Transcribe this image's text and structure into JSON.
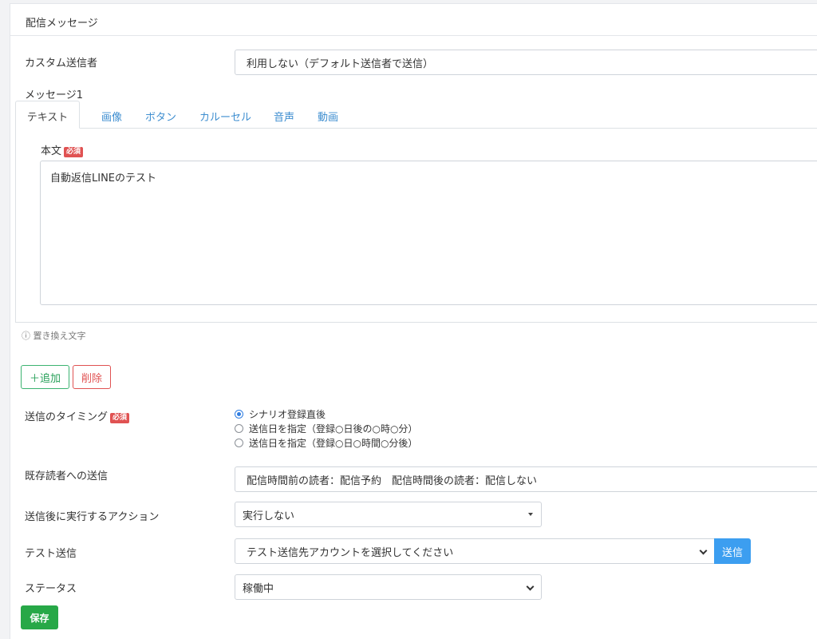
{
  "panel": {
    "title": "配信メッセージ"
  },
  "custom_sender": {
    "label": "カスタム送信者",
    "value": "利用しない（デフォルト送信者で送信）"
  },
  "message": {
    "heading": "メッセージ1",
    "tabs": [
      "テキスト",
      "画像",
      "ボタン",
      "カルーセル",
      "音声",
      "動画"
    ],
    "active_tab": "テキスト",
    "body_label": "本文",
    "required_badge": "必須",
    "body_value": "自動返信LINEのテスト",
    "hint": "ⓘ 置き換え文字"
  },
  "actions": {
    "add_label": "＋追加",
    "delete_label": "削除"
  },
  "timing": {
    "label": "送信のタイミング",
    "required_badge": "必須",
    "options": [
      {
        "label": "シナリオ登録直後",
        "checked": true
      },
      {
        "label": "送信日を指定（登録○日後の○時○分）",
        "checked": false
      },
      {
        "label": "送信日を指定（登録○日○時間○分後）",
        "checked": false
      }
    ]
  },
  "existing_readers": {
    "label": "既存読者への送信",
    "value": "配信時間前の読者：配信予約　配信時間後の読者：配信しない"
  },
  "post_action": {
    "label": "送信後に実行するアクション",
    "value": "実行しない"
  },
  "test_send": {
    "label": "テスト送信",
    "value": "テスト送信先アカウントを選択してください",
    "button": "送信"
  },
  "status": {
    "label": "ステータス",
    "value": "稼働中"
  },
  "save_button": "保存",
  "colors": {
    "accent_blue": "#3c9ef0",
    "save_green": "#27a847",
    "required_red": "#e05252"
  }
}
